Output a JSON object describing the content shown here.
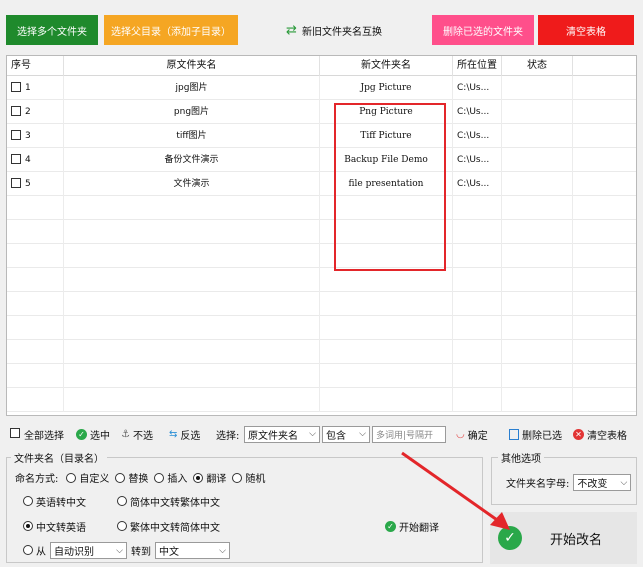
{
  "topbar": {
    "select_multiple": "选择多个文件夹",
    "select_parent": "选择父目录（添加子目录）",
    "swap_names": "新旧文件夹名互换",
    "delete_selected": "删除已选的文件夹",
    "clear_table": "清空表格"
  },
  "table": {
    "headers": [
      "序号",
      "原文件夹名",
      "新文件夹名",
      "所在位置",
      "状态"
    ],
    "rows": [
      {
        "seq": "1",
        "old": "jpg图片",
        "new": "Jpg Picture",
        "loc": "C:\\Us..."
      },
      {
        "seq": "2",
        "old": "png图片",
        "new": "Png Picture",
        "loc": "C:\\Us..."
      },
      {
        "seq": "3",
        "old": "tiff图片",
        "new": "Tiff Picture",
        "loc": "C:\\Us..."
      },
      {
        "seq": "4",
        "old": "备份文件演示",
        "new": "Backup File Demo",
        "loc": "C:\\Us..."
      },
      {
        "seq": "5",
        "old": "文件演示",
        "new": "file presentation",
        "loc": "C:\\Us..."
      }
    ]
  },
  "toolbar": {
    "select_all": "全部选择",
    "select": "选中",
    "deselect": "不选",
    "invert": "反选",
    "choose_label": "选择:",
    "field_value": "原文件夹名",
    "match_value": "包含",
    "keyword_placeholder": "多词用|号隔开",
    "confirm": "确定",
    "delete_selected": "删除已选",
    "clear_table": "清空表格"
  },
  "rename_group": {
    "title": "文件夹名（目录名）",
    "mode_label": "命名方式:",
    "modes": [
      "自定义",
      "替换",
      "插入",
      "翻译",
      "随机"
    ],
    "selected_mode": "翻译",
    "options": {
      "en_to_cn": "英语转中文",
      "simp_to_trad": "简体中文转繁体中文",
      "cn_to_en": "中文转英语",
      "trad_to_simp": "繁体中文转简体中文",
      "from_label": "从",
      "from_value": "自动识别",
      "to_label": "转到",
      "to_value": "中文"
    },
    "start_translate": "开始翻译"
  },
  "other_group": {
    "title": "其他选项",
    "case_label": "文件夹名字母:",
    "case_value": "不改变"
  },
  "start_button": "开始改名",
  "colors": {
    "green": "#1f8a2c",
    "orange": "#f5a623",
    "pink": "#ff4f8b",
    "red": "#ef1b1b",
    "highlight": "#e3262a"
  }
}
